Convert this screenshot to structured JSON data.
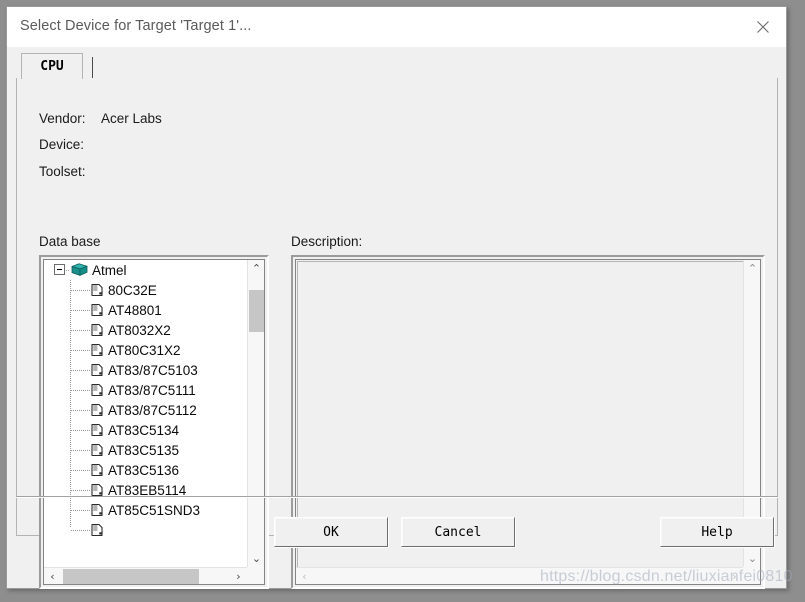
{
  "window": {
    "title": "Select Device for Target 'Target 1'...",
    "close_icon": "close-icon"
  },
  "tabs": [
    {
      "label": "CPU",
      "selected": true
    }
  ],
  "info": {
    "vendor_label": "Vendor:",
    "vendor_value": "Acer Labs",
    "device_label": "Device:",
    "device_value": "",
    "toolset_label": "Toolset:",
    "toolset_value": ""
  },
  "sections": {
    "database_label": "Data base",
    "description_label": "Description:"
  },
  "tree": {
    "root": {
      "label": "Atmel",
      "icon": "book-icon",
      "expanded": true
    },
    "items": [
      {
        "label": "80C32E",
        "icon": "chip-icon"
      },
      {
        "label": "AT48801",
        "icon": "chip-icon"
      },
      {
        "label": "AT8032X2",
        "icon": "chip-icon"
      },
      {
        "label": "AT80C31X2",
        "icon": "chip-icon"
      },
      {
        "label": "AT83/87C5103",
        "icon": "chip-icon"
      },
      {
        "label": "AT83/87C5111",
        "icon": "chip-icon"
      },
      {
        "label": "AT83/87C5112",
        "icon": "chip-icon"
      },
      {
        "label": "AT83C5134",
        "icon": "chip-icon"
      },
      {
        "label": "AT83C5135",
        "icon": "chip-icon"
      },
      {
        "label": "AT83C5136",
        "icon": "chip-icon"
      },
      {
        "label": "AT83EB5114",
        "icon": "chip-icon"
      },
      {
        "label": "AT85C51SND3",
        "icon": "chip-icon"
      }
    ]
  },
  "description": {
    "text": ""
  },
  "scrollbars": {
    "up_arrow": "⌃",
    "down_arrow": "⌄",
    "left_arrow": "‹",
    "right_arrow": "›"
  },
  "buttons": {
    "ok": "OK",
    "cancel": "Cancel",
    "help": "Help"
  },
  "watermark": "https://blog.csdn.net/liuxianfei0810",
  "colors": {
    "desktop": "#8e8e8e",
    "dialog_face": "#f0f0f0",
    "titlebar": "#ffffff",
    "title_text": "#5a5a5a",
    "list_background": "#ffffff",
    "book_icon": "#1f8f8f",
    "scroll_thumb": "#c6c6c6"
  }
}
